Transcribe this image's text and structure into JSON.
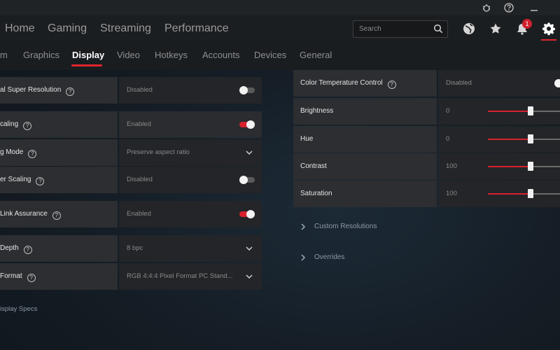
{
  "colors": {
    "accent": "#e0242e",
    "toggle_on": "#d9202d",
    "panel": "#2c2e31"
  },
  "titlebar": {
    "icons": [
      "bug-report-icon",
      "help-icon",
      "minimize-icon"
    ]
  },
  "header": {
    "nav": [
      "Home",
      "Gaming",
      "Streaming",
      "Performance"
    ],
    "search_placeholder": "Search",
    "notification_count": "1",
    "icons": [
      "globe-icon",
      "star-icon",
      "bell-icon",
      "gear-icon"
    ]
  },
  "subnav": {
    "tabs": [
      "m",
      "Graphics",
      "Display",
      "Video",
      "Hotkeys",
      "Accounts",
      "Devices",
      "General"
    ],
    "active": "Display"
  },
  "left_settings": [
    {
      "label": "al Super Resolution",
      "value": "Disabled",
      "control": "toggle",
      "on": false
    },
    {
      "label": "caling",
      "value": "Enabled",
      "control": "toggle",
      "on": true
    },
    {
      "label": "g Mode",
      "value": "Preserve aspect ratio",
      "control": "dropdown"
    },
    {
      "label": "er Scaling",
      "value": "Disabled",
      "control": "toggle",
      "on": false
    },
    {
      "label": "Link Assurance",
      "value": "Enabled",
      "control": "toggle",
      "on": true
    },
    {
      "label": "Depth",
      "value": "8 bpc",
      "control": "dropdown"
    },
    {
      "label": "Format",
      "value": "RGB 4:4:4 Pixel Format PC Stand...",
      "control": "dropdown"
    }
  ],
  "left_footer": "isplay Specs",
  "right_settings": [
    {
      "label": "Color Temperature Control",
      "value": "Disabled",
      "control": "toggle",
      "on": false
    },
    {
      "label": "Brightness",
      "value": "0",
      "control": "slider",
      "level": 0.5
    },
    {
      "label": "Hue",
      "value": "0",
      "control": "slider",
      "level": 0.5
    },
    {
      "label": "Contrast",
      "value": "100",
      "control": "slider",
      "level": 0.5
    },
    {
      "label": "Saturation",
      "value": "100",
      "control": "slider",
      "level": 0.5
    }
  ],
  "expanders": [
    "Custom Resolutions",
    "Overrides"
  ]
}
